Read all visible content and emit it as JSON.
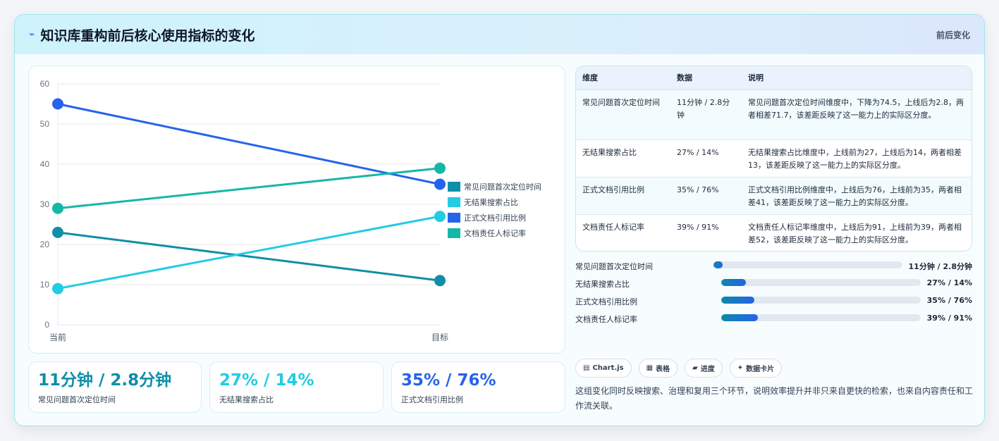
{
  "header": {
    "icon": "⌁",
    "title": "知识库重构前后核心使用指标的变化",
    "tag": "前后变化"
  },
  "chart_data": {
    "type": "line",
    "categories": [
      "当前",
      "目标"
    ],
    "ylim": [
      0,
      60
    ],
    "yticks": [
      0,
      10,
      20,
      30,
      40,
      50,
      60
    ],
    "grid": true,
    "legend_position": "right",
    "series": [
      {
        "name": "常见问题首次定位时间",
        "values": [
          23,
          11
        ],
        "color": "#0e8fa8"
      },
      {
        "name": "无结果搜索占比",
        "values": [
          9,
          27
        ],
        "color": "#22cce3"
      },
      {
        "name": "正式文档引用比例",
        "values": [
          55,
          35
        ],
        "color": "#2563eb"
      },
      {
        "name": "文档责任人标记率",
        "values": [
          29,
          39
        ],
        "color": "#14b8a6"
      }
    ]
  },
  "stats": [
    {
      "value": "11分钟 / 2.8分钟",
      "label": "常见问题首次定位时间",
      "color": "#0e8fa8"
    },
    {
      "value": "27% / 14%",
      "label": "无结果搜索占比",
      "color": "#22cce3"
    },
    {
      "value": "35% / 76%",
      "label": "正式文档引用比例",
      "color": "#2563eb"
    }
  ],
  "table": {
    "headers": [
      "维度",
      "数据",
      "说明"
    ],
    "rows": [
      [
        "常见问题首次定位时间",
        "11分钟 / 2.8分钟",
        "常见问题首次定位时间维度中，下降为74.5，上线后为2.8，两者相差71.7，该差距反映了这一能力上的实际区分度。"
      ],
      [
        "无结果搜索占比",
        "27% / 14%",
        "无结果搜索占比维度中，上线前为27，上线后为14，两者相差13，该差距反映了这一能力上的实际区分度。"
      ],
      [
        "正式文档引用比例",
        "35% / 76%",
        "正式文档引用比例维度中，上线后为76，上线前为35，两者相差41，该差距反映了这一能力上的实际区分度。"
      ],
      [
        "文档责任人标记率",
        "39% / 91%",
        "文档责任人标记率维度中，上线后为91，上线前为39，两者相差52，该差距反映了这一能力上的实际区分度。"
      ]
    ]
  },
  "progress": [
    {
      "label": "常见问题首次定位时间",
      "value": "11分钟 / 2.8分钟",
      "fraction": 0.05
    },
    {
      "label": "无结果搜索占比",
      "value": "27% / 14%",
      "fraction": 0.125
    },
    {
      "label": "正式文档引用比例",
      "value": "35% / 76%",
      "fraction": 0.165
    },
    {
      "label": "文档责任人标记率",
      "value": "39% / 91%",
      "fraction": 0.185
    }
  ],
  "chips": [
    {
      "icon": "▤",
      "label": "Chart.js"
    },
    {
      "icon": "▦",
      "label": "表格"
    },
    {
      "icon": "▰",
      "label": "进度"
    },
    {
      "icon": "✦",
      "label": "数据卡片"
    }
  ],
  "note": "这组变化同时反映搜索、治理和复用三个环节，说明效率提升并非只来自更快的检索，也来自内容责任和工作流关联。"
}
